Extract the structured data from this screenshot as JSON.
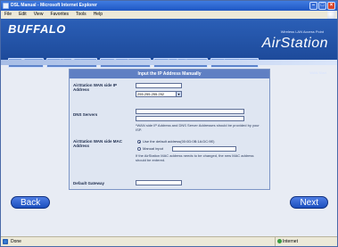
{
  "window": {
    "title": "DSL Manual - Microsoft Internet Explorer"
  },
  "menu": [
    "File",
    "Edit",
    "View",
    "Favorites",
    "Tools",
    "Help"
  ],
  "header": {
    "logo": "BUFFALO",
    "tagline": "Wireless LAN Access Point",
    "brand": "AirStation",
    "subtab": "WAN Start"
  },
  "nav": {
    "tabs": [
      "Top",
      "Line Test",
      "Security",
      "Application",
      "Logout"
    ]
  },
  "form": {
    "title": "Input the IP Address Manually",
    "wan_ip_label": "AirStation WAN side IP Address",
    "wan_ip_value": "",
    "subnet_value": "255.255.255.252",
    "dns_label": "DNS Servers",
    "dns_primary_value": "",
    "dns_secondary_value": "",
    "dns_note": "*WAN side IP Address and DNS Server Addresses should be provided by your ISP.",
    "mac_label": "AirStation WAN side MAC Address",
    "mac_option_default": "Use the default address(00:0D:0B:1A:DC:9E)",
    "mac_option_manual": "Manual input",
    "mac_manual_value": "",
    "mac_note": "If the AirStation MAC address needs to be changed, the new MAC address should be entered.",
    "gateway_label": "Default Gateway",
    "gateway_value": ""
  },
  "buttons": {
    "back": "Back",
    "next": "Next"
  },
  "status": {
    "left": "Done",
    "zone": "Internet"
  },
  "colors": {
    "accent": "#2b5fb7",
    "form_header": "#5f7fc3"
  }
}
